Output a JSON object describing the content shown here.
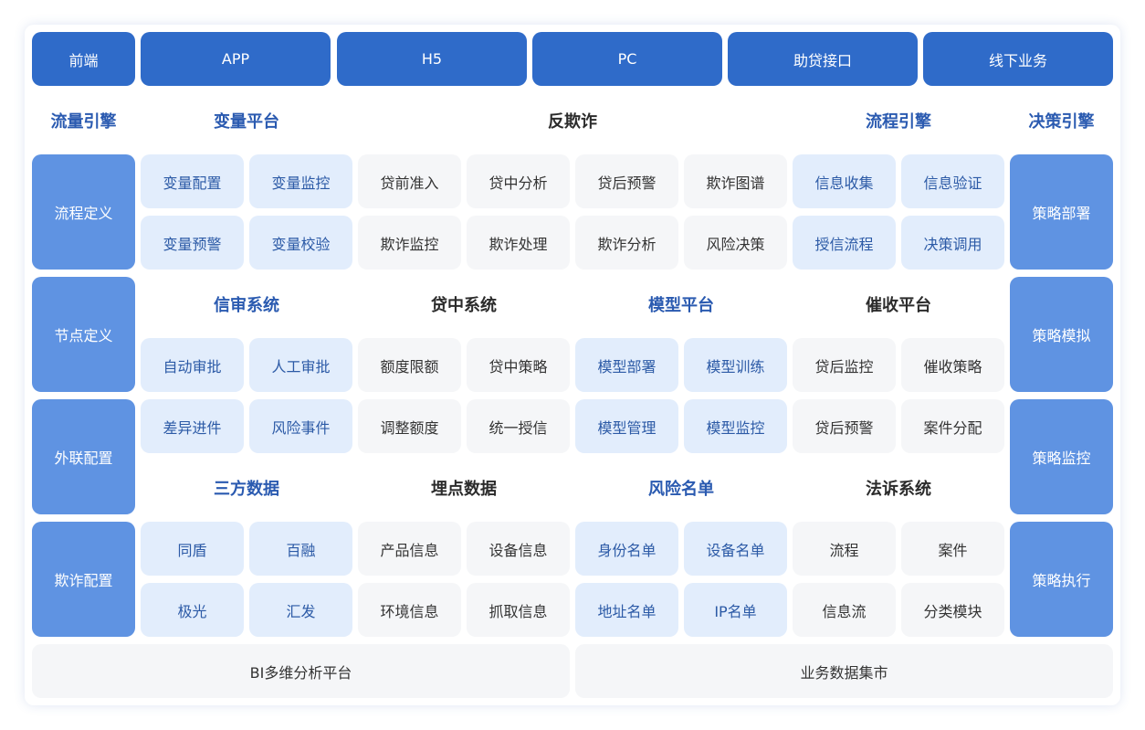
{
  "top_bar": [
    "前端",
    "APP",
    "H5",
    "PC",
    "助贷接口",
    "线下业务"
  ],
  "header_row": [
    "流量引擎",
    "变量平台",
    "反欺诈",
    "流程引擎",
    "决策引擎"
  ],
  "left_column": [
    "流程定义",
    "节点定义",
    "外联配置",
    "欺诈配置"
  ],
  "right_column": [
    "策略部署",
    "策略模拟",
    "策略监控",
    "策略执行"
  ],
  "section1": {
    "row1": [
      "变量配置",
      "变量监控",
      "贷前准入",
      "贷中分析",
      "贷后预警",
      "欺诈图谱",
      "信息收集",
      "信息验证"
    ],
    "row2": [
      "变量预警",
      "变量校验",
      "欺诈监控",
      "欺诈处理",
      "欺诈分析",
      "风险决策",
      "授信流程",
      "决策调用"
    ]
  },
  "section2": {
    "headers": [
      "信审系统",
      "贷中系统",
      "模型平台",
      "催收平台"
    ],
    "row1": [
      "自动审批",
      "人工审批",
      "额度限额",
      "贷中策略",
      "模型部署",
      "模型训练",
      "贷后监控",
      "催收策略"
    ],
    "row2": [
      "差异进件",
      "风险事件",
      "调整额度",
      "统一授信",
      "模型管理",
      "模型监控",
      "贷后预警",
      "案件分配"
    ]
  },
  "section3": {
    "headers": [
      "三方数据",
      "埋点数据",
      "风险名单",
      "法诉系统"
    ],
    "row1": [
      "同盾",
      "百融",
      "产品信息",
      "设备信息",
      "身份名单",
      "设备名单",
      "流程",
      "案件"
    ],
    "row2": [
      "极光",
      "汇发",
      "环境信息",
      "抓取信息",
      "地址名单",
      "IP名单",
      "信息流",
      "分类模块"
    ]
  },
  "bottom_bar": [
    "BI多维分析平台",
    "业务数据集市"
  ]
}
